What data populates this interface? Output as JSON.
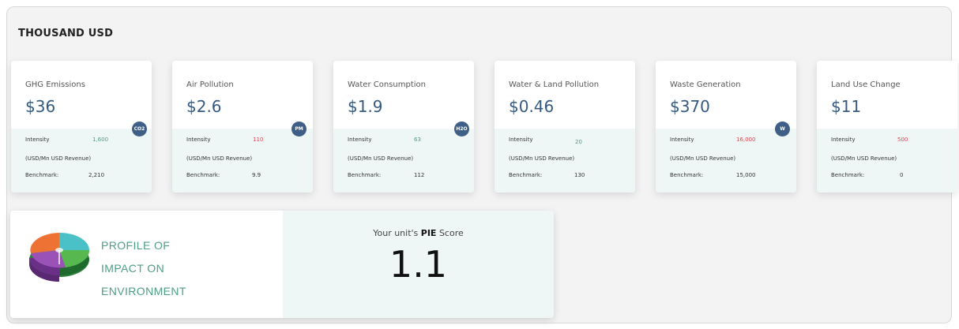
{
  "header": {
    "title": "THOUSAND USD"
  },
  "colors": {
    "value": "#35597f",
    "badge": "#3f5f86",
    "teal_positive": "#4e9d84",
    "red_negative": "#e8404e",
    "panel_tint": "#eef7f6"
  },
  "cards": [
    {
      "name": "GHG Emissions",
      "value": "$36",
      "badge": "CO2",
      "intensity_label": "Intensity",
      "intensity": "1,600",
      "intensity_color": "#4e9d84",
      "unit_note": "(USD/Mn USD Revenue)",
      "benchmark_label": "Benchmark:",
      "benchmark": "2,210"
    },
    {
      "name": "Air Pollution",
      "value": "$2.6",
      "badge": "PM",
      "intensity_label": "Intensity",
      "intensity": "110",
      "intensity_color": "#e8404e",
      "unit_note": "(USD/Mn USD Revenue)",
      "benchmark_label": "Benchmark:",
      "benchmark": "9.9"
    },
    {
      "name": "Water Consumption",
      "value": "$1.9",
      "badge": "H2O",
      "intensity_label": "Intensity",
      "intensity": "63",
      "intensity_color": "#4e9d84",
      "unit_note": "(USD/Mn USD Revenue)",
      "benchmark_label": "Benchmark:",
      "benchmark": "112"
    },
    {
      "name": "Water & Land Pollution",
      "value": "$0.46",
      "badge": "",
      "intensity_label": "Intensity",
      "intensity": "20",
      "intensity_color": "#4e9d84",
      "unit_note": "(USD/Mn USD Revenue)",
      "benchmark_label": "Benchmark:",
      "benchmark": "130"
    },
    {
      "name": "Waste Generation",
      "value": "$370",
      "badge": "W",
      "intensity_label": "Intensity",
      "intensity": "16,000",
      "intensity_color": "#e8404e",
      "unit_note": "(USD/Mn USD Revenue)",
      "benchmark_label": "Benchmark:",
      "benchmark": "15,000"
    },
    {
      "name": "Land Use Change",
      "value": "$11",
      "badge": "",
      "intensity_label": "Intensity",
      "intensity": "500",
      "intensity_color": "#e8404e",
      "unit_note": "(USD/Mn USD Revenue)",
      "benchmark_label": "Benchmark:",
      "benchmark": "0"
    }
  ],
  "pie_summary": {
    "profile_lines": [
      "PROFILE OF",
      "IMPACT ON",
      "ENVIRONMENT"
    ],
    "score_label_prefix": "Your unit's",
    "score_label_bold": "PIE",
    "score_label_suffix": "Score",
    "score": "1.1",
    "logo_icon": "pie-chart-logo-icon"
  }
}
